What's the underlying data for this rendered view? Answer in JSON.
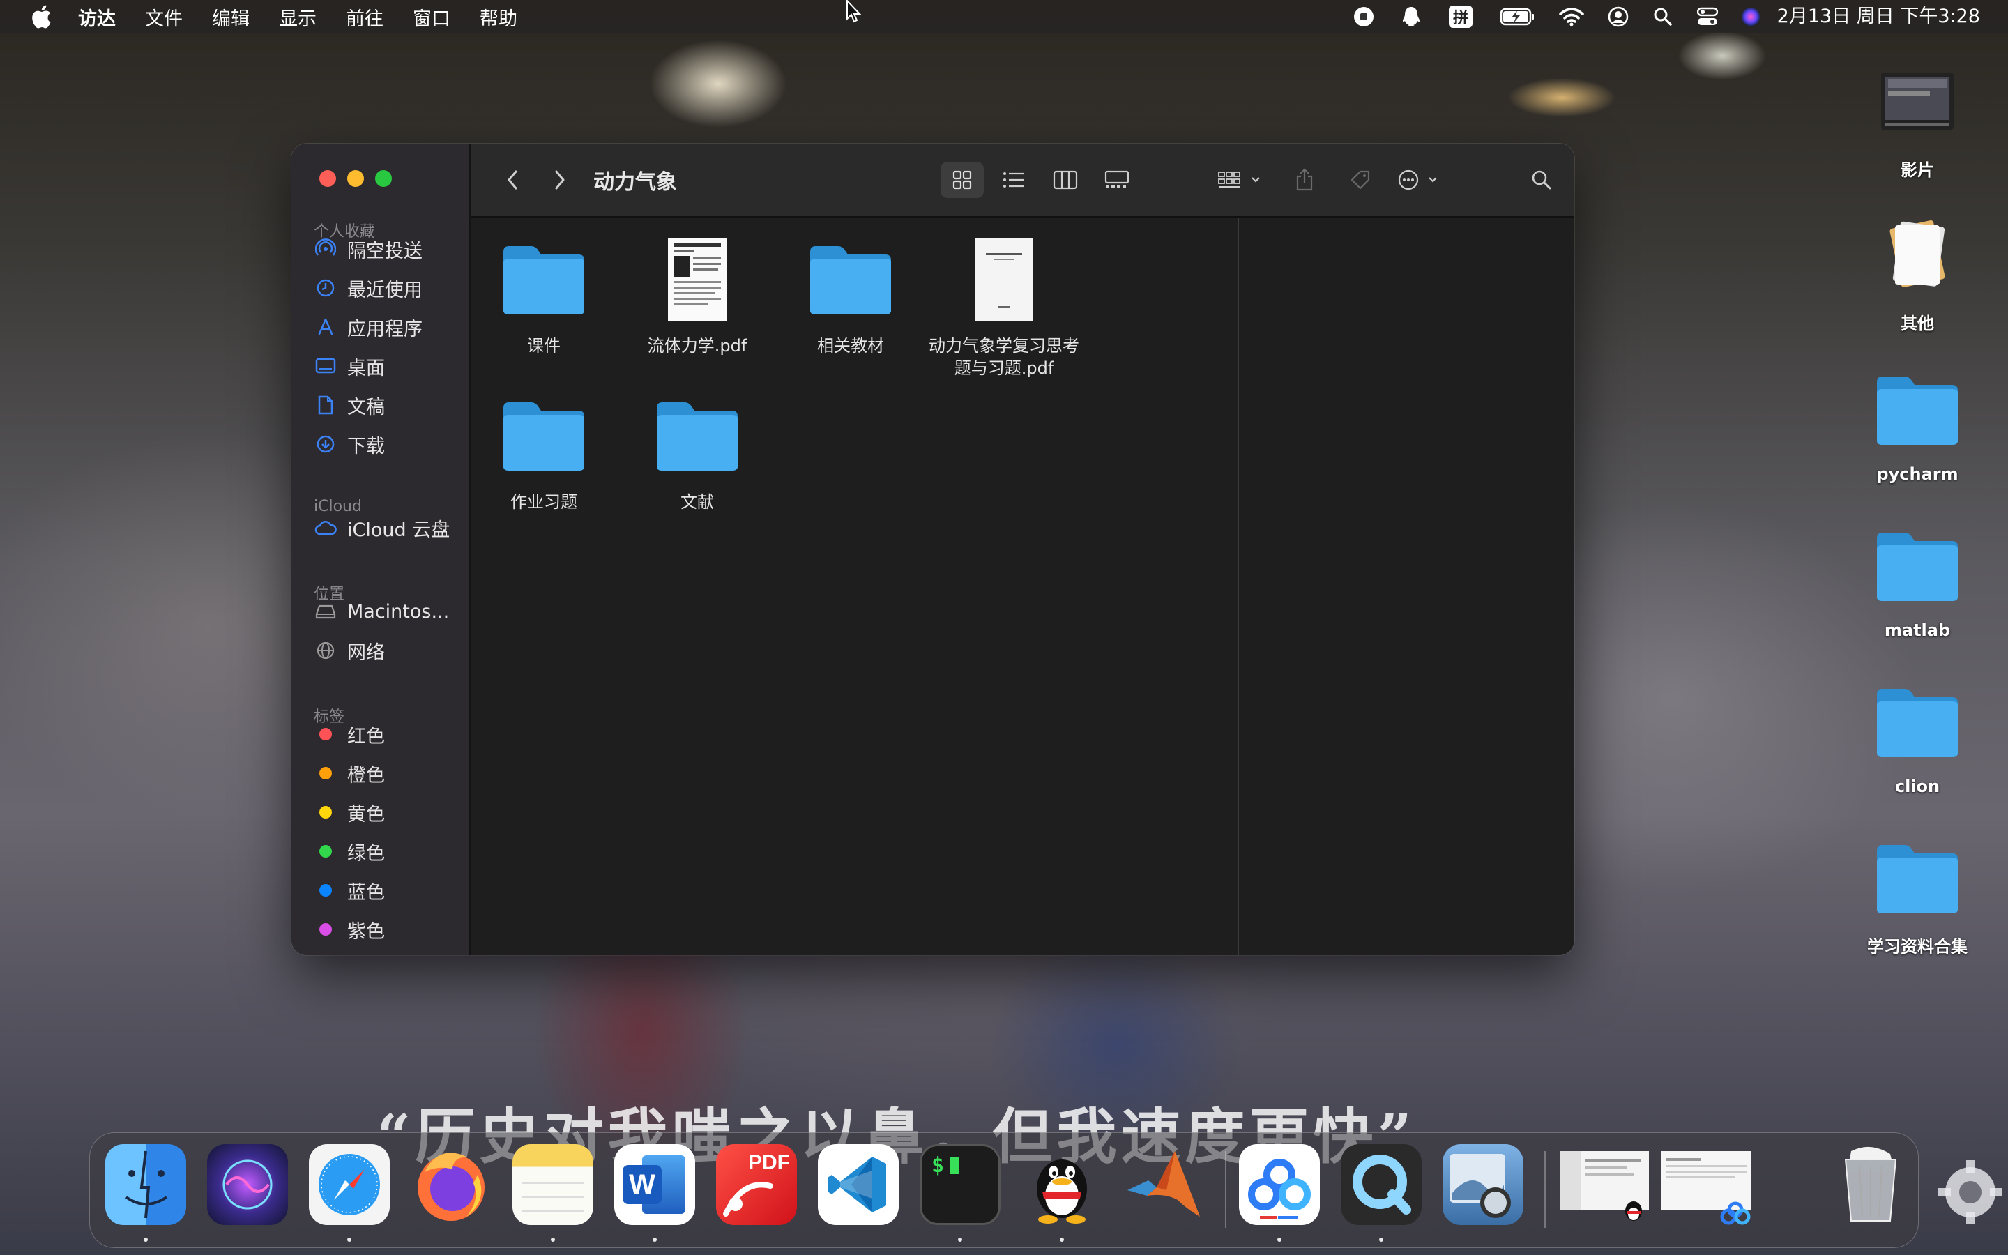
{
  "menubar": {
    "menus": [
      "访达",
      "文件",
      "编辑",
      "显示",
      "前往",
      "窗口",
      "帮助"
    ],
    "status_icons": [
      "screen-record-icon",
      "qq-status-icon",
      "input-method-icon",
      "battery-icon",
      "wifi-icon",
      "user-icon",
      "spotlight-icon",
      "control-center-icon",
      "siri-icon"
    ],
    "input_method": "拼",
    "clock": "2月13日 周日 下午3:28"
  },
  "finder": {
    "title": "动力气象",
    "sidebar": {
      "favorites_header": "个人收藏",
      "favorites": [
        "隔空投送",
        "最近使用",
        "应用程序",
        "桌面",
        "文稿",
        "下载"
      ],
      "icloud_header": "iCloud",
      "icloud": [
        "iCloud 云盘"
      ],
      "locations_header": "位置",
      "locations": [
        "Macintos...",
        "网络"
      ],
      "tags_header": "标签",
      "tags": [
        {
          "label": "红色",
          "color": "#ff5257"
        },
        {
          "label": "橙色",
          "color": "#ff9f0a"
        },
        {
          "label": "黄色",
          "color": "#ffd60a"
        },
        {
          "label": "绿色",
          "color": "#32d74b"
        },
        {
          "label": "蓝色",
          "color": "#0a84ff"
        },
        {
          "label": "紫色",
          "color": "#da4de6"
        }
      ]
    },
    "files": [
      {
        "name": "课件",
        "kind": "folder"
      },
      {
        "name": "流体力学.pdf",
        "kind": "pdf"
      },
      {
        "name": "相关教材",
        "kind": "folder"
      },
      {
        "name": "动力气象学复习思考题与习题.pdf",
        "kind": "pdf"
      },
      {
        "name": "作业习题",
        "kind": "folder"
      },
      {
        "name": "文献",
        "kind": "folder"
      }
    ]
  },
  "desktop": {
    "icons": [
      "影片",
      "其他",
      "pycharm",
      "matlab",
      "clion",
      "学习资料合集"
    ]
  },
  "wallpaper_text": "“历史对我嗤之以鼻，但我速度更快”",
  "dock": {
    "apps": [
      "finder-app",
      "siri-app",
      "safari-app",
      "firefox-app",
      "notes-app",
      "word-app",
      "pdf-expert-app",
      "vscode-app",
      "terminal-app",
      "qq-app",
      "matlab-app",
      "baidu-netdisk-app",
      "quicktime-app",
      "preview-app"
    ],
    "word_letter": "W",
    "pdf_label": "PDF",
    "terminal_prompt": "$"
  },
  "colors": {
    "folder": "#3ea8f0",
    "accent": "#0a84ff"
  }
}
